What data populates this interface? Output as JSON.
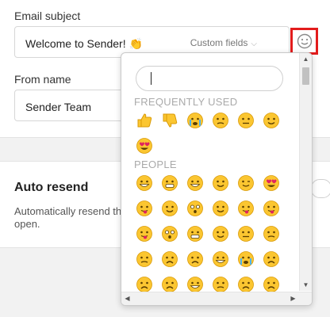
{
  "email_subject": {
    "label": "Email subject",
    "value": "Welcome to Sender! 👏",
    "custom_fields_label": "Custom fields"
  },
  "from_name": {
    "label": "From name",
    "value": "Sender Team"
  },
  "auto_resend": {
    "title": "Auto resend",
    "description_line1": "Automatically resend th",
    "description_line2": "open."
  },
  "emoji_picker": {
    "search_value": "",
    "frequently_used_title": "FREQUENTLY USED",
    "people_title": "PEOPLE",
    "frequently_used": [
      "thumbs-up",
      "thumbs-down",
      "loudly-crying",
      "confused",
      "neutral",
      "smiling",
      "star-struck"
    ],
    "people": [
      "grinning",
      "grimacing",
      "beaming",
      "blush",
      "winking",
      "heart-eyes",
      "kissing",
      "relieved",
      "hushed",
      "smiling",
      "tongue-out",
      "squinting-tongue",
      "tongue-out",
      "flushed",
      "grimacing",
      "smiling",
      "expressionless",
      "unamused",
      "pensive",
      "confounded",
      "sad",
      "laughing",
      "crying",
      "sad-sweat",
      "weary",
      "fearful",
      "sweat-smile",
      "worried",
      "tired",
      "angry"
    ]
  },
  "colors": {
    "highlight_border": "#e21c1c",
    "emoji_yellow": "#fbc631",
    "emoji_outline": "#d99a06"
  }
}
